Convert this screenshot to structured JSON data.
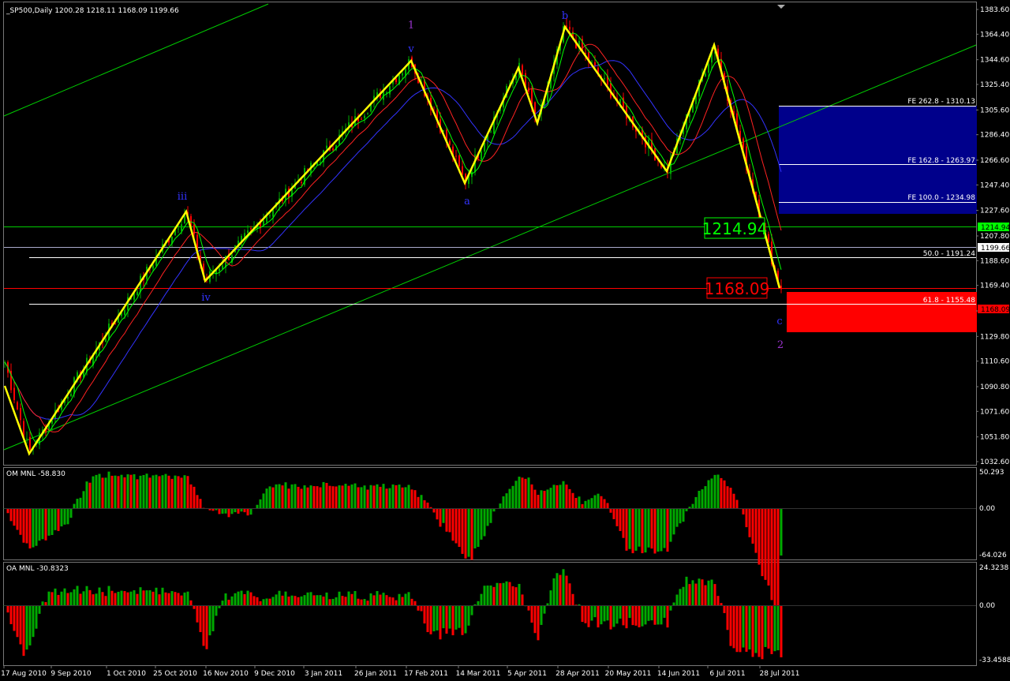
{
  "main_panel": {
    "info": "_SP500,Daily  1200.28 1218.11 1168.09 1199.66",
    "price_labels": [
      "1383.60",
      "1364.40",
      "1344.60",
      "1325.40",
      "1305.60",
      "1286.40",
      "1266.60",
      "1247.40",
      "1227.60",
      "1207.80",
      "1188.60",
      "1169.40",
      "1149.60",
      "1129.80",
      "1110.60",
      "1090.80",
      "1071.60",
      "1051.80",
      "1032.60"
    ],
    "badges": [
      {
        "text": "1214.94",
        "color": "#00ff00",
        "text_color": "#000000"
      },
      {
        "text": "1199.66",
        "color": "#ffffff",
        "text_color": "#000000"
      },
      {
        "text": "1168.09",
        "color": "#ff0000",
        "text_color": "#000000"
      }
    ],
    "big_labels": {
      "upper": "1214.94",
      "lower": "1168.09"
    },
    "levels": [
      {
        "label": "FE 262.8 - 1310.13",
        "value": 1310.13
      },
      {
        "label": "FE 162.8 - 1263.97",
        "value": 1263.97
      },
      {
        "label": "FE 100.0 - 1234.98",
        "value": 1234.98
      },
      {
        "label": "50.0 - 1191.24",
        "value": 1191.24
      },
      {
        "label": "61.8 - 1155.48",
        "value": 1155.48
      }
    ],
    "waves": [
      {
        "text": "1",
        "color": "#9933cc"
      },
      {
        "text": "v",
        "color": "#3333ff"
      },
      {
        "text": "iii",
        "color": "#3333ff"
      },
      {
        "text": "iv",
        "color": "#3333ff"
      },
      {
        "text": "a",
        "color": "#3333ff"
      },
      {
        "text": "b",
        "color": "#3333ff"
      },
      {
        "text": "c",
        "color": "#3333ff"
      },
      {
        "text": "2",
        "color": "#9933cc"
      }
    ]
  },
  "om_panel": {
    "title": "OM MNL -58.830",
    "labels": [
      "50.293",
      "0.00",
      "-64.026"
    ]
  },
  "oa_panel": {
    "title": "OA MNL -30.8323",
    "labels": [
      "24.3238",
      "0.00",
      "-33.4588"
    ]
  },
  "x_labels": [
    "17 Aug 2010",
    "9 Sep 2010",
    "1 Oct 2010",
    "25 Oct 2010",
    "16 Nov 2010",
    "9 Dec 2010",
    "3 Jan 2011",
    "26 Jan 2011",
    "17 Feb 2011",
    "14 Mar 2011",
    "5 Apr 2011",
    "28 Apr 2011",
    "20 May 2011",
    "14 Jun 2011",
    "6 Jul 2011",
    "28 Jul 2011"
  ],
  "colors": {
    "up": "#00aa00",
    "down": "#ff0000",
    "wave_line": "#ffff00",
    "channel": "#00cc00",
    "blue_zone": "#00008b",
    "red_zone": "#ff0000",
    "ma_blue": "#3333ff",
    "ma_red": "#ff2222",
    "ma_green": "#00ff00"
  },
  "chart_data": {
    "type": "candlestick",
    "title": "_SP500,Daily",
    "ohlc_last": {
      "open": 1200.28,
      "high": 1218.11,
      "low": 1168.09,
      "close": 1199.66
    },
    "ylim": [
      1032.6,
      1383.6
    ],
    "wave_pivots": [
      {
        "label": "",
        "date": "17 Aug 2010",
        "value": 1110
      },
      {
        "label": "",
        "date": "27 Aug 2010",
        "value": 1040
      },
      {
        "label": "iii",
        "date": "5 Nov 2010",
        "value": 1227
      },
      {
        "label": "iv",
        "date": "16 Nov 2010",
        "value": 1173
      },
      {
        "label": "v",
        "date": "18 Feb 2011",
        "value": 1344
      },
      {
        "label": "a",
        "date": "16 Mar 2011",
        "value": 1250
      },
      {
        "label": "",
        "date": "1 Apr 2011",
        "value": 1340
      },
      {
        "label": "",
        "date": "18 Apr 2011",
        "value": 1295
      },
      {
        "label": "b",
        "date": "2 May 2011",
        "value": 1370
      },
      {
        "label": "",
        "date": "16 Jun 2011",
        "value": 1258
      },
      {
        "label": "",
        "date": "7 Jul 2011",
        "value": 1356
      },
      {
        "label": "c",
        "date": "8 Aug 2011",
        "value": 1168
      }
    ],
    "horizontal_lines": [
      1214.94,
      1199.66,
      1191.24,
      1168.09,
      1155.48
    ],
    "zones": [
      {
        "name": "blue",
        "from": 1226,
        "to": 1310.13
      },
      {
        "name": "red",
        "from": 1133,
        "to": 1166
      }
    ],
    "om_mnl": {
      "last": -58.83,
      "ylim": [
        -64.026,
        50.293
      ]
    },
    "oa_mnl": {
      "last": -30.8323,
      "ylim": [
        -33.4588,
        24.3238
      ]
    }
  }
}
